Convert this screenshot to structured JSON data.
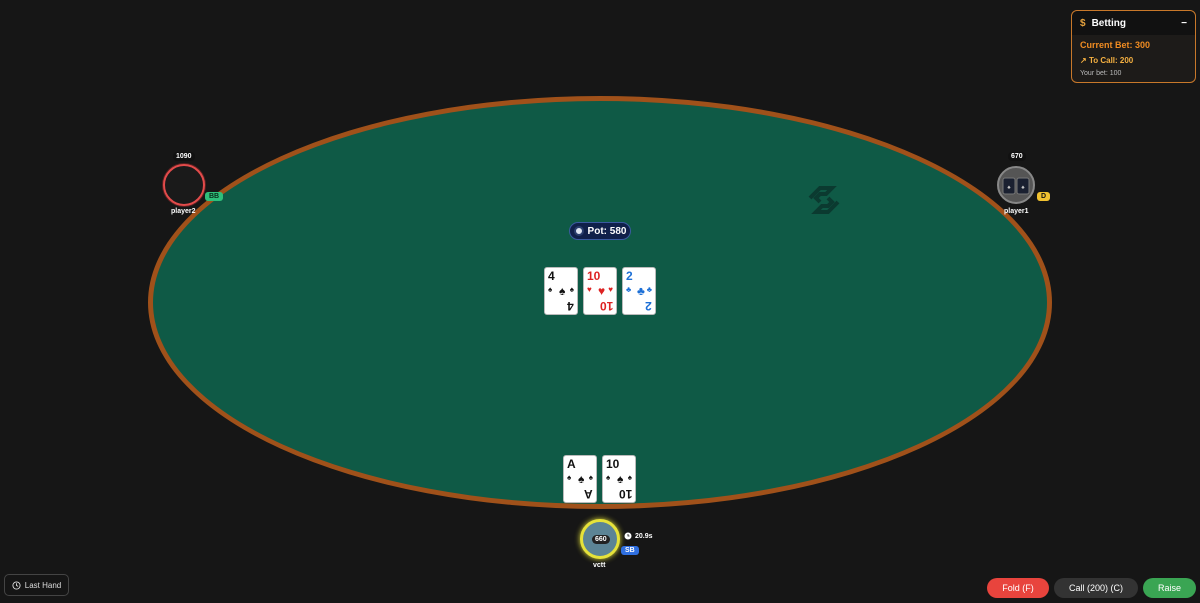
{
  "pot": {
    "label": "Pot: 580"
  },
  "community_cards": [
    {
      "rank": "4",
      "suit": "♠",
      "color": "black"
    },
    {
      "rank": "10",
      "suit": "♥",
      "color": "red"
    },
    {
      "rank": "2",
      "suit": "♣",
      "color": "blue"
    }
  ],
  "hero": {
    "name": "vctt",
    "stack": "660",
    "position_badge": "SB",
    "timer": "20.9s",
    "cards": [
      {
        "rank": "A",
        "suit": "♠",
        "color": "black"
      },
      {
        "rank": "10",
        "suit": "♠",
        "color": "black"
      }
    ]
  },
  "players": {
    "left": {
      "name": "player2",
      "stack": "1090",
      "badge": "BB"
    },
    "right": {
      "name": "player1",
      "stack": "670",
      "badge": "D"
    }
  },
  "betting": {
    "title": "Betting",
    "collapse_glyph": "−",
    "current_bet": "Current Bet: 300",
    "to_call": "To Call: 200",
    "your_bet": "Your bet: 100"
  },
  "controls": {
    "last_hand": "Last Hand",
    "fold": "Fold (F)",
    "call": "Call (200) (C)",
    "raise": "Raise"
  },
  "colors": {
    "felt": "#0f5a46",
    "rail": "#a0511a",
    "accent": "#f08c22",
    "fold": "#e8443d",
    "raise": "#3aa553"
  }
}
